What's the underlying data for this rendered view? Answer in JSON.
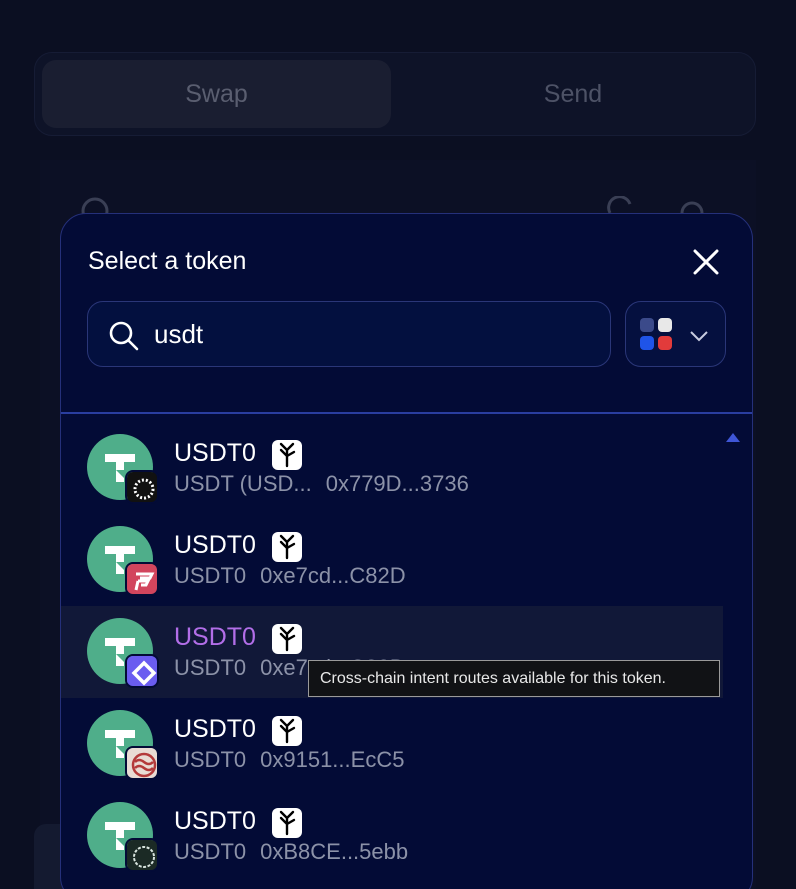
{
  "background": {
    "tabs": [
      {
        "label": "Swap",
        "active": true
      },
      {
        "label": "Send",
        "active": false
      }
    ]
  },
  "modal": {
    "title": "Select a token",
    "search": {
      "value": "usdt",
      "placeholder": ""
    },
    "chain_filter_colors": [
      "#3b6ad9",
      "#e8e8e8",
      "#1f54e8",
      "#e23b3b"
    ]
  },
  "tokens": [
    {
      "symbol": "USDT0",
      "name": "USDT (USD...",
      "address": "0x779D...3736",
      "chain_color": "#111111",
      "chain_icon": "sunburst-chain-icon"
    },
    {
      "symbol": "USDT0",
      "name": "USDT0",
      "address": "0xe7cd...C82D",
      "chain_color": "#d2455d",
      "chain_icon": "flare-chain-icon"
    },
    {
      "symbol": "USDT0",
      "name": "USDT0",
      "address": "0xe7cd...C82D",
      "chain_color": "#6a5cf0",
      "chain_icon": "diamond-chain-icon"
    },
    {
      "symbol": "USDT0",
      "name": "USDT0",
      "address": "0x9151...EcC5",
      "chain_color": "#e9dcd4",
      "chain_icon": "sei-chain-icon"
    },
    {
      "symbol": "USDT0",
      "name": "USDT0",
      "address": "0xB8CE...5ebb",
      "chain_color": "#1b2a25",
      "chain_icon": "ring-chain-icon"
    }
  ],
  "tooltip": {
    "text": "Cross-chain intent routes available for this token."
  }
}
